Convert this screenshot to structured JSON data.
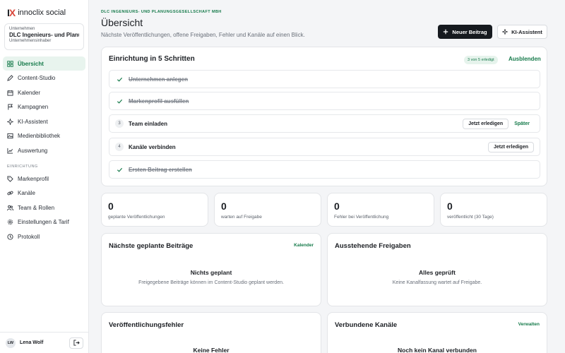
{
  "brand": {
    "mark_i": "I",
    "mark_x": "X",
    "name": "innoclix social"
  },
  "company": {
    "label": "Unternehmen",
    "name": "DLC Ingenieurs- und Planu",
    "role": "Unternehmensinhaber"
  },
  "nav": {
    "items": [
      {
        "label": "Übersicht",
        "icon": "dashboard-icon",
        "active": true
      },
      {
        "label": "Content-Studio",
        "icon": "pen-icon"
      },
      {
        "label": "Kalender",
        "icon": "calendar-icon"
      },
      {
        "label": "Kampagnen",
        "icon": "flag-icon"
      },
      {
        "label": "KI-Assistent",
        "icon": "sparkle-icon"
      },
      {
        "label": "Medienbibliothek",
        "icon": "media-icon"
      },
      {
        "label": "Auswertung",
        "icon": "chart-icon"
      }
    ],
    "section_label": "EINRICHTUNG",
    "setup_items": [
      {
        "label": "Markenprofil",
        "icon": "tag-icon"
      },
      {
        "label": "Kanäle",
        "icon": "link-icon"
      },
      {
        "label": "Team & Rollen",
        "icon": "users-icon"
      },
      {
        "label": "Einstellungen & Tarif",
        "icon": "gear-icon"
      },
      {
        "label": "Protokoll",
        "icon": "history-icon"
      }
    ]
  },
  "user": {
    "initials": "LW",
    "name": "Lena Wolf"
  },
  "header": {
    "eyebrow": "DLC INGENIEURS- UND PLANUNGSGESELLSCHAFT MBH",
    "title": "Übersicht",
    "subtitle": "Nächste Veröffentlichungen, offene Freigaben, Fehler und Kanäle auf einen Blick.",
    "new_post": "Neuer Beitrag",
    "ai_assistant": "KI-Assistent"
  },
  "setup": {
    "title": "Einrichtung in 5 Schritten",
    "progress": "3 von 5 erledigt",
    "hide": "Ausblenden",
    "steps": [
      {
        "num": "1",
        "label": "Unternehmen anlegen",
        "done": true
      },
      {
        "num": "2",
        "label": "Markenprofil ausfüllen",
        "done": true
      },
      {
        "num": "3",
        "label": "Team einladen",
        "done": false,
        "action": "Jetzt erledigen",
        "later": "Später"
      },
      {
        "num": "4",
        "label": "Kanäle verbinden",
        "done": false,
        "action": "Jetzt erledigen"
      },
      {
        "num": "5",
        "label": "Ersten Beitrag erstellen",
        "done": true
      }
    ]
  },
  "stats": [
    {
      "value": "0",
      "label": "geplante Veröffentlichungen"
    },
    {
      "value": "0",
      "label": "warten auf Freigabe"
    },
    {
      "value": "0",
      "label": "Fehler bei Veröffentlichung"
    },
    {
      "value": "0",
      "label": "veröffentlicht (30 Tage)"
    }
  ],
  "panels": {
    "scheduled": {
      "title": "Nächste geplante Beiträge",
      "link": "Kalender",
      "empty_title": "Nichts geplant",
      "empty_sub": "Freigegebene Beiträge können im Content-Studio geplant werden."
    },
    "approvals": {
      "title": "Ausstehende Freigaben",
      "empty_title": "Alles geprüft",
      "empty_sub": "Keine Kanalfassung wartet auf Freigabe."
    },
    "errors": {
      "title": "Veröffentlichungsfehler",
      "empty_title": "Keine Fehler"
    },
    "channels": {
      "title": "Verbundene Kanäle",
      "link": "Verwalten",
      "empty_title": "Noch kein Kanal verbunden"
    }
  },
  "colors": {
    "accent": "#157a4a",
    "accent_bg": "#e8f4ee",
    "brand_x": "#d9473b",
    "primary_button": "#161a1f"
  }
}
